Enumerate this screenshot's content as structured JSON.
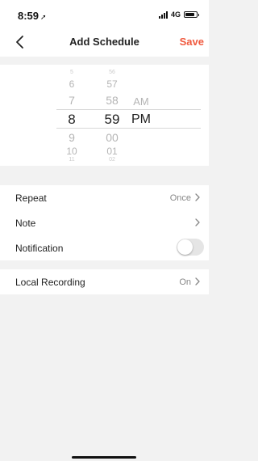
{
  "status_bar": {
    "time": "8:59",
    "location_arrow": "➚",
    "network": "4G"
  },
  "nav": {
    "back_icon": "chevron-left-icon",
    "title": "Add Schedule",
    "save_label": "Save"
  },
  "picker": {
    "hours": [
      "5",
      "6",
      "7",
      "8",
      "9",
      "10",
      "11"
    ],
    "minutes": [
      "56",
      "57",
      "58",
      "59",
      "00",
      "01",
      "02"
    ],
    "ampm": [
      "AM",
      "PM"
    ],
    "selected": {
      "hour": "8",
      "minute": "59",
      "ampm": "PM"
    }
  },
  "settings": {
    "repeat": {
      "label": "Repeat",
      "value": "Once"
    },
    "note": {
      "label": "Note"
    },
    "notification": {
      "label": "Notification",
      "enabled": false
    },
    "local_recording": {
      "label": "Local Recording",
      "value": "On"
    }
  },
  "colors": {
    "accent": "#f0593e",
    "background": "#f2f2f2",
    "toggle_off": "#e5e5e5"
  }
}
